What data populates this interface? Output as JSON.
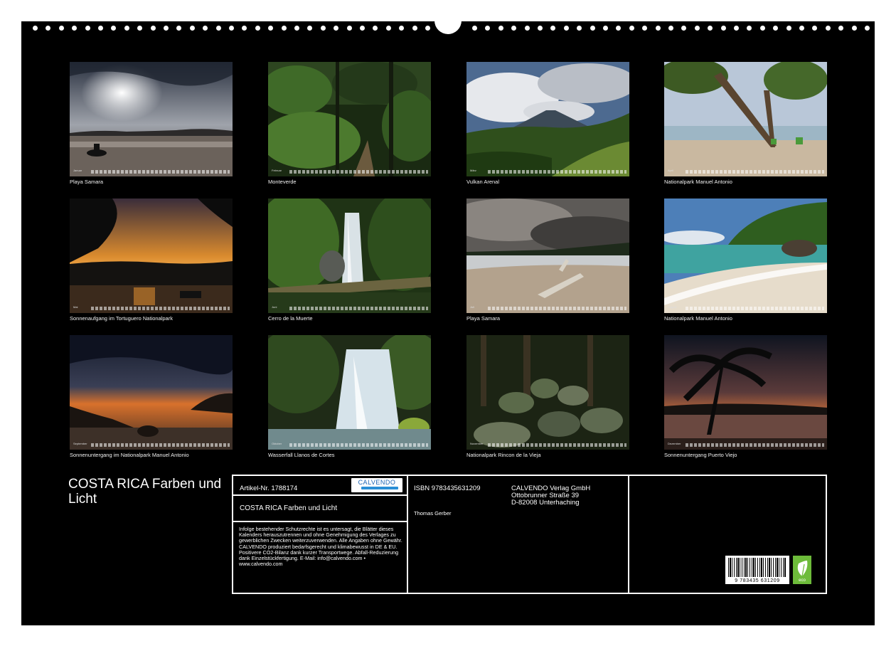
{
  "calendar": {
    "title": "COSTA RICA Farben und Licht",
    "months": [
      {
        "month": "Januar",
        "caption": "Playa Samara"
      },
      {
        "month": "Februar",
        "caption": "Monteverde"
      },
      {
        "month": "März",
        "caption": "Vulkan Arenal"
      },
      {
        "month": "April",
        "caption": "Nationalpark Manuel Antonio"
      },
      {
        "month": "Mai",
        "caption": "Sonnenaufgang im Tortuguero Nationalpark"
      },
      {
        "month": "Juni",
        "caption": "Cerro de la Muerte"
      },
      {
        "month": "Juli",
        "caption": "Playa Samara"
      },
      {
        "month": "August",
        "caption": "Nationalpark Manuel Antonio"
      },
      {
        "month": "September",
        "caption": "Sonnenuntergang im Nationalpark Manuel Antonio"
      },
      {
        "month": "Oktober",
        "caption": "Wasserfall Llanos de Cortes"
      },
      {
        "month": "November",
        "caption": "Nationalpark Rincon de la Vieja"
      },
      {
        "month": "Dezember",
        "caption": "Sonnenuntergang Puerto Viejo"
      }
    ]
  },
  "info": {
    "article": "Artikel-Nr. 1788174",
    "logo_text": "CALVENDO",
    "product_title": "COSTA RICA Farben und Licht",
    "legal": "Infolge bestehender Schutzrechte ist es untersagt, die Blätter dieses Kalenders herauszutrennen und ohne Genehmigung des Verlages zu gewerblichen Zwecken weiterzuverwenden. Alle Angaben ohne Gewähr. CALVENDO produziert bedarfsgerecht und klimabewusst in DE & EU. Positivere CO2-Bilanz dank kurzer Transportwege. Abfall-Reduzierung dank Einzelstückfertigung. E-Mail: info@calvendo.com • www.calvendo.com",
    "isbn": "ISBN 9783435631209",
    "author": "Thomas Gerber",
    "publisher_name": "CALVENDO Verlag GmbH",
    "publisher_street": "Ottobrunner Straße 39",
    "publisher_city": "D-82008 Unterhaching",
    "barcode_number": "9 783435 631209",
    "eco_label": "eco"
  }
}
